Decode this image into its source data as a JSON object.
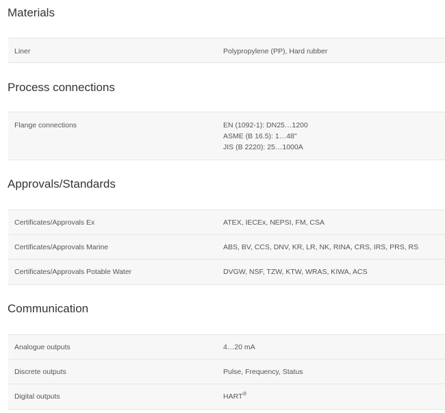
{
  "sections": [
    {
      "title": "Materials",
      "rows": [
        {
          "label": "Liner",
          "values": [
            "Polypropylene (PP), Hard rubber"
          ]
        }
      ]
    },
    {
      "title": "Process connections",
      "rows": [
        {
          "label": "Flange connections",
          "values": [
            "EN (1092-1): DN25…1200",
            "ASME (B 16.5): 1…48\"",
            "JIS (B 2220): 25…1000A"
          ]
        }
      ]
    },
    {
      "title": "Approvals/Standards",
      "rows": [
        {
          "label": "Certificates/Approvals Ex",
          "values": [
            "ATEX, IECEx, NEPSI, FM, CSA"
          ]
        },
        {
          "label": "Certificates/Approvals Marine",
          "values": [
            "ABS, BV, CCS, DNV, KR, LR, NK, RINA, CRS, IRS, PRS, RS"
          ]
        },
        {
          "label": "Certificates/Approvals Potable Water",
          "values": [
            "DVGW, NSF, TZW, KTW, WRAS, KIWA, ACS"
          ]
        }
      ]
    },
    {
      "title": "Communication",
      "rows": [
        {
          "label": "Analogue outputs",
          "values": [
            "4…20 mA"
          ]
        },
        {
          "label": "Discrete outputs",
          "values": [
            "Pulse, Frequency, Status"
          ]
        },
        {
          "label": "Digital outputs",
          "values": [
            "HART"
          ],
          "value_sup": "®"
        }
      ]
    }
  ]
}
